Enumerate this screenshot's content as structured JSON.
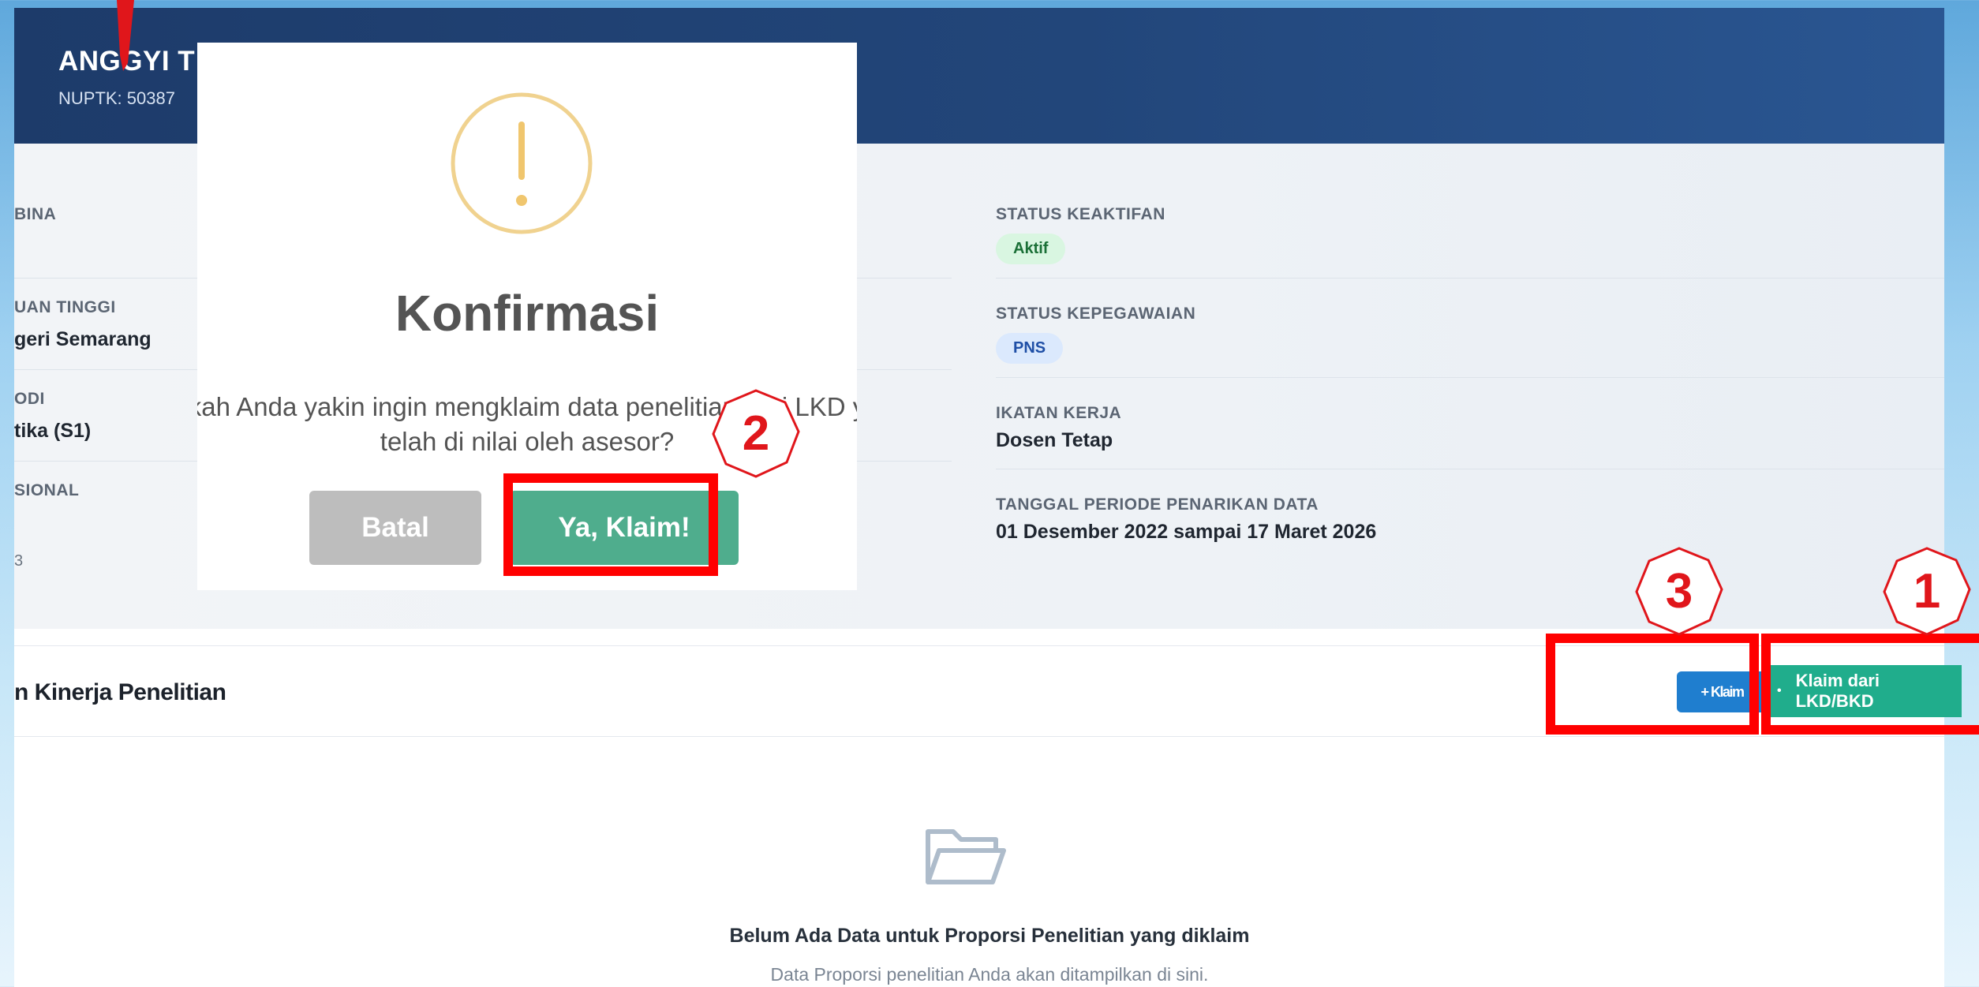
{
  "profile": {
    "name": "ANGGYI T",
    "nuptk": "NUPTK: 50387"
  },
  "left_fields": [
    {
      "label": "BINA",
      "value": ""
    },
    {
      "label": "UAN TINGGI",
      "value": "geri Semarang"
    },
    {
      "label": "ODI",
      "value": "tika (S1)"
    },
    {
      "label": "SIONAL",
      "value": "3"
    }
  ],
  "right_fields": {
    "status_keaktifan": {
      "label": "STATUS KEAKTIFAN",
      "badge": "Aktif"
    },
    "status_kepegawaian": {
      "label": "STATUS KEPEGAWAIAN",
      "badge": "PNS"
    },
    "ikatan_kerja": {
      "label": "IKATAN KERJA",
      "value": "Dosen Tetap"
    },
    "periode": {
      "label": "TANGGAL PERIODE PENARIKAN DATA",
      "value": "01 Desember 2022 sampai 17 Maret 2026"
    }
  },
  "section": {
    "title": "n Kinerja Penelitian",
    "klaim_button": "+ Klaim",
    "lkd_button_bullet": "•",
    "lkd_button": "Klaim dari LKD/BKD"
  },
  "empty_state": {
    "icon": "folder-open-icon",
    "title": "Belum Ada Data untuk Proporsi Penelitian yang diklaim",
    "subtitle": "Data Proporsi penelitian Anda akan ditampilkan di sini."
  },
  "modal": {
    "icon": "warning-icon",
    "title": "Konfirmasi",
    "text_line1": "akah Anda yakin ingin mengklaim data penelitian dari LKD ya",
    "text_line2": "telah di nilai oleh asesor?",
    "cancel_label": "Batal",
    "confirm_label": "Ya, Klaim!"
  },
  "annotations": {
    "step1": "1",
    "step2": "2",
    "step3": "3",
    "color": "#ff0000"
  },
  "colors": {
    "hero": "#22467a",
    "confirm": "#4fad8d",
    "lkd": "#20ad8c",
    "klaim": "#1f7ecf"
  }
}
